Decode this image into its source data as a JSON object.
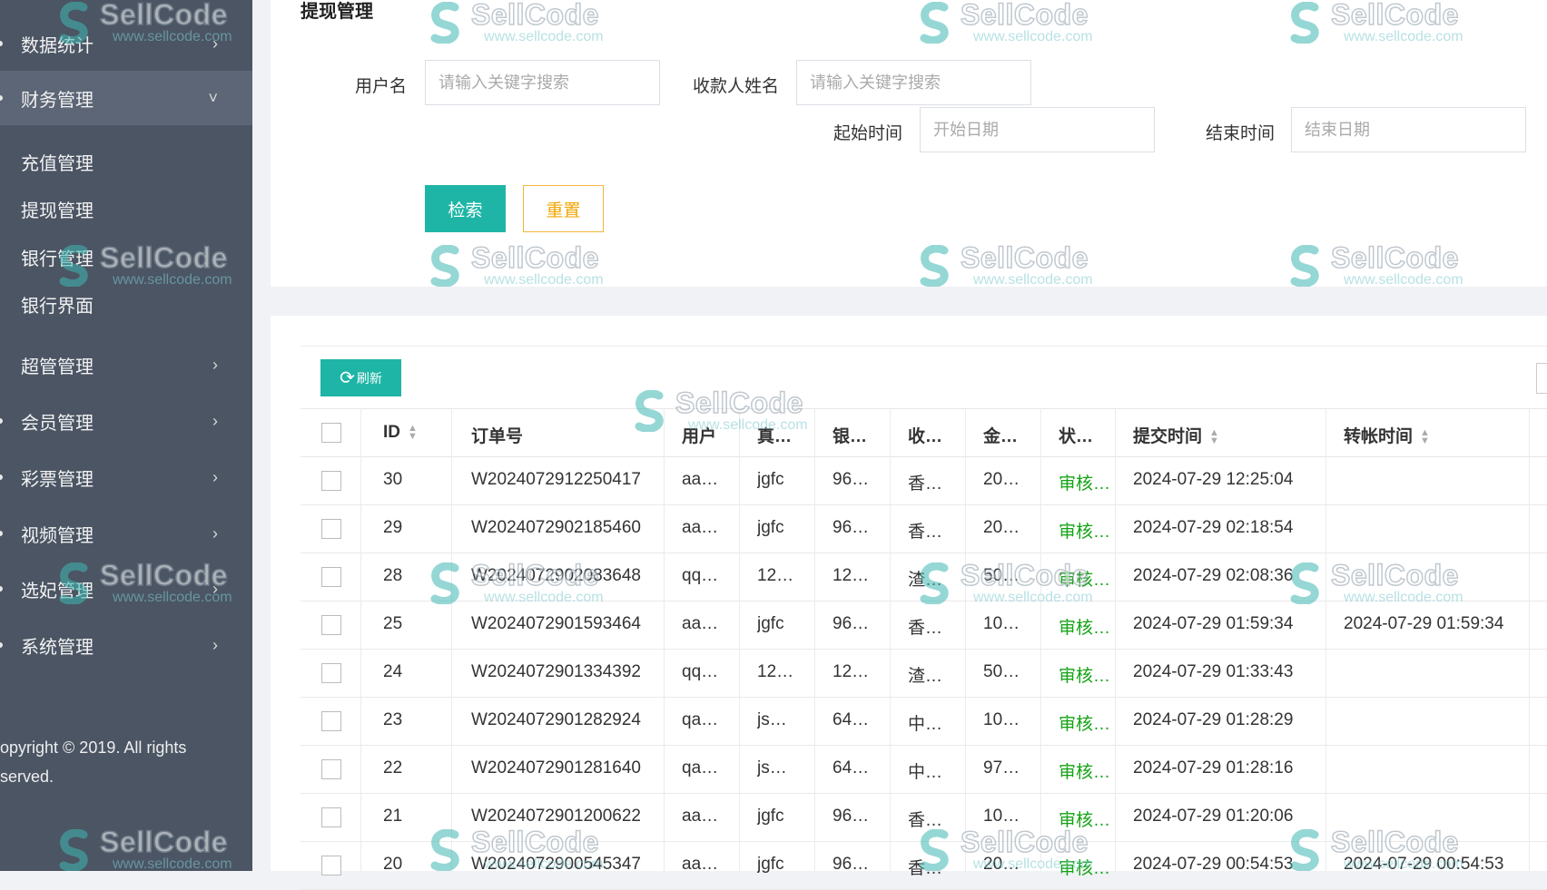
{
  "sidebar": {
    "items": [
      {
        "label": "数据统计"
      },
      {
        "label": "财务管理"
      },
      {
        "label": "超管管理"
      },
      {
        "label": "会员管理"
      },
      {
        "label": "彩票管理"
      },
      {
        "label": "视频管理"
      },
      {
        "label": "选妃管理"
      },
      {
        "label": "系统管理"
      }
    ],
    "subitems": [
      {
        "label": "充值管理"
      },
      {
        "label": "提现管理"
      },
      {
        "label": "银行管理"
      },
      {
        "label": "银行界面"
      }
    ],
    "copyright_line1": "opyright © 2019. All rights",
    "copyright_line2": "served."
  },
  "page": {
    "title": "提现管理"
  },
  "filters": {
    "username_label": "用户名",
    "username_placeholder": "请输入关键字搜索",
    "payee_label": "收款人姓名",
    "payee_placeholder": "请输入关键字搜索",
    "start_label": "起始时间",
    "start_placeholder": "开始日期",
    "end_label": "结束时间",
    "end_placeholder": "结束日期",
    "search_label": "检索",
    "reset_label": "重置"
  },
  "toolbar": {
    "refresh_label": "刷新"
  },
  "table": {
    "headers": {
      "id": "ID",
      "order": "订单号",
      "user": "用户",
      "name": "真…",
      "bank": "银…",
      "payee": "收…",
      "amount": "金…",
      "status": "状…",
      "submit": "提交时间",
      "transfer": "转帐时间"
    },
    "rows": [
      {
        "id": "30",
        "order": "W2024072912250417",
        "user": "aa…",
        "name": "jgfc",
        "bank": "96…",
        "payee": "香…",
        "amount": "20…",
        "status": "审核通过",
        "submit": "2024-07-29 12:25:04",
        "transfer": ""
      },
      {
        "id": "29",
        "order": "W2024072902185460",
        "user": "aa…",
        "name": "jgfc",
        "bank": "96…",
        "payee": "香…",
        "amount": "20…",
        "status": "审核通过",
        "submit": "2024-07-29 02:18:54",
        "transfer": ""
      },
      {
        "id": "28",
        "order": "W2024072902083648",
        "user": "qq…",
        "name": "12…",
        "bank": "12…",
        "payee": "渣…",
        "amount": "50…",
        "status": "审核通过",
        "submit": "2024-07-29 02:08:36",
        "transfer": ""
      },
      {
        "id": "25",
        "order": "W2024072901593464",
        "user": "aa…",
        "name": "jgfc",
        "bank": "96…",
        "payee": "香…",
        "amount": "10…",
        "status": "审核通过",
        "submit": "2024-07-29 01:59:34",
        "transfer": "2024-07-29 01:59:34"
      },
      {
        "id": "24",
        "order": "W2024072901334392",
        "user": "qq…",
        "name": "12…",
        "bank": "12…",
        "payee": "渣…",
        "amount": "50…",
        "status": "审核通过",
        "submit": "2024-07-29 01:33:43",
        "transfer": ""
      },
      {
        "id": "23",
        "order": "W2024072901282924",
        "user": "qa…",
        "name": "js…",
        "bank": "64…",
        "payee": "中…",
        "amount": "10…",
        "status": "审核通过",
        "submit": "2024-07-29 01:28:29",
        "transfer": ""
      },
      {
        "id": "22",
        "order": "W2024072901281640",
        "user": "qa…",
        "name": "js…",
        "bank": "64…",
        "payee": "中…",
        "amount": "97…",
        "status": "审核通过",
        "submit": "2024-07-29 01:28:16",
        "transfer": ""
      },
      {
        "id": "21",
        "order": "W2024072901200622",
        "user": "aa…",
        "name": "jgfc",
        "bank": "96…",
        "payee": "香…",
        "amount": "10…",
        "status": "审核通过",
        "submit": "2024-07-29 01:20:06",
        "transfer": ""
      },
      {
        "id": "20",
        "order": "W2024072900545347",
        "user": "aa…",
        "name": "jgfc",
        "bank": "96…",
        "payee": "香…",
        "amount": "20…",
        "status": "审核通过",
        "submit": "2024-07-29 00:54:53",
        "transfer": "2024-07-29 00:54:53"
      }
    ]
  },
  "watermark": {
    "name": "SellCode",
    "url": "www.sellcode.com"
  },
  "colors": {
    "sidebar": "#4b5564",
    "accent": "#1fb5a6",
    "reset": "#f0a500",
    "status": "#13a313"
  }
}
